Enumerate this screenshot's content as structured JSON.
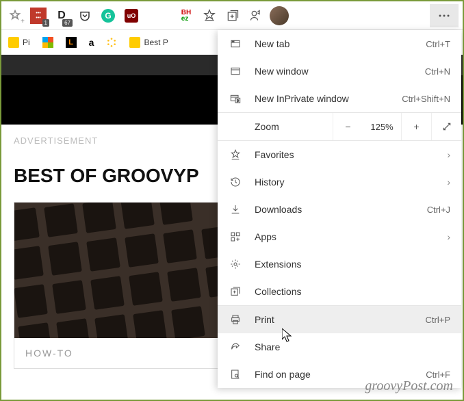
{
  "toolbar": {
    "badge1": "1",
    "badge2": "67"
  },
  "bookmarks": {
    "pi": "Pi",
    "best": "Best P"
  },
  "page": {
    "ad": "ADVERTISEMENT",
    "headline": "BEST OF GROOVYP",
    "howto": "HOW-TO"
  },
  "menu": {
    "newtab": {
      "label": "New tab",
      "shortcut": "Ctrl+T"
    },
    "newwin": {
      "label": "New window",
      "shortcut": "Ctrl+N"
    },
    "inprivate": {
      "label": "New InPrivate window",
      "shortcut": "Ctrl+Shift+N"
    },
    "zoom": {
      "label": "Zoom",
      "value": "125%"
    },
    "favorites": {
      "label": "Favorites"
    },
    "history": {
      "label": "History"
    },
    "downloads": {
      "label": "Downloads",
      "shortcut": "Ctrl+J"
    },
    "apps": {
      "label": "Apps"
    },
    "extensions": {
      "label": "Extensions"
    },
    "collections": {
      "label": "Collections"
    },
    "print": {
      "label": "Print",
      "shortcut": "Ctrl+P"
    },
    "share": {
      "label": "Share"
    },
    "find": {
      "label": "Find on page",
      "shortcut": "Ctrl+F"
    }
  },
  "watermark": "groovyPost.com"
}
